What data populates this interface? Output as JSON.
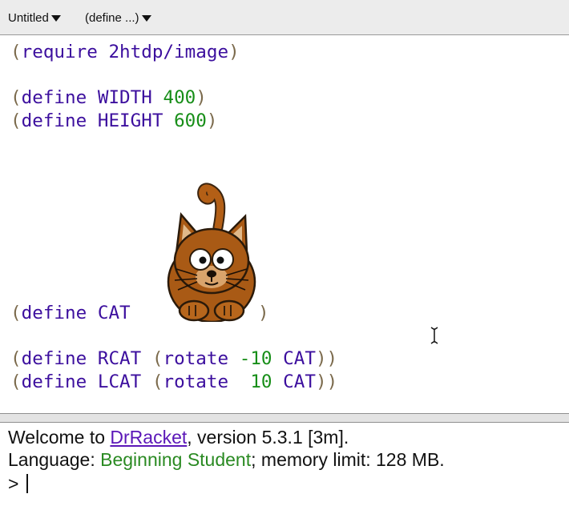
{
  "toolbar": {
    "file_menu": "Untitled",
    "define_menu": "(define ...)"
  },
  "editor": {
    "lines": [
      {
        "open": "(",
        "kw": "require",
        "name": "2htdp/image",
        "num": "",
        "close": ")"
      },
      {
        "open": "(",
        "kw": "define",
        "name": "WIDTH",
        "num": "400",
        "close": ")"
      },
      {
        "open": "(",
        "kw": "define",
        "name": "HEIGHT",
        "num": "600",
        "close": ")"
      },
      {
        "open": "(",
        "kw": "define",
        "name": "CAT",
        "num": "",
        "close": ")"
      },
      {
        "open": "(",
        "kw": "define",
        "name": "RCAT",
        "inner_open": "(",
        "fn": "rotate",
        "num": "-10",
        "arg": "CAT",
        "close": "))"
      },
      {
        "open": "(",
        "kw": "define",
        "name": "LCAT",
        "inner_open": "(",
        "fn": "rotate",
        "num": "10",
        "arg": "CAT",
        "close": "))"
      }
    ],
    "image_icon": "cat-icon"
  },
  "interactions": {
    "welcome_prefix": "Welcome to ",
    "app_link": "DrRacket",
    "welcome_suffix": ", version 5.3.1 [3m].",
    "language_prefix": "Language: ",
    "language_name": "Beginning Student",
    "language_suffix": "; memory limit: 128 MB.",
    "prompt": ">"
  },
  "colors": {
    "keyword": "#3c0f9e",
    "number": "#178e18",
    "paren": "#7b6a4c",
    "language": "#2a8a22",
    "link": "#5b17b8"
  }
}
